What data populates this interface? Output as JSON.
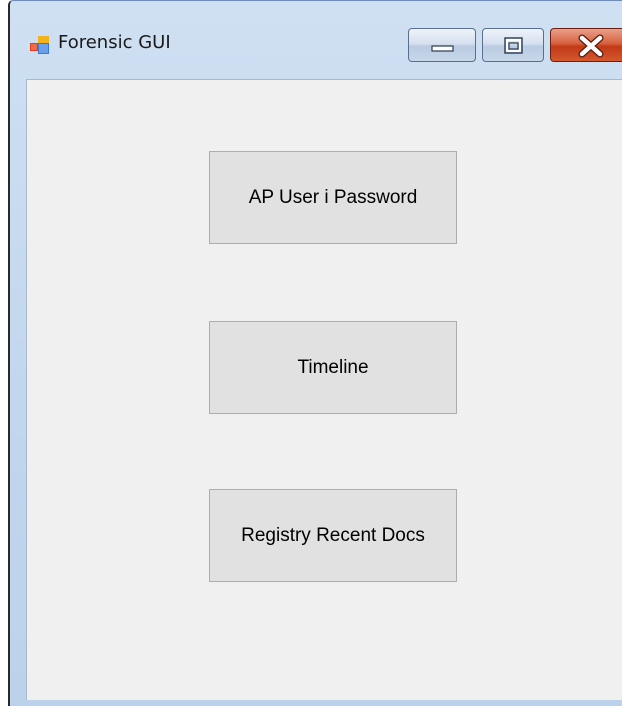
{
  "window": {
    "title": "Forensic GUI",
    "icon": "windows-form-icon",
    "controls": [
      "minimize-icon",
      "maximize-icon",
      "close-icon"
    ]
  },
  "buttons": [
    {
      "label": "AP User i Password"
    },
    {
      "label": "Timeline"
    },
    {
      "label": "Registry Recent Docs"
    }
  ],
  "colors": {
    "titlebar": "#c3d7ee",
    "client_background": "#f0f0f0",
    "button_face": "#e1e1e1",
    "button_border": "#adadad",
    "close_button": "#c13a16"
  }
}
